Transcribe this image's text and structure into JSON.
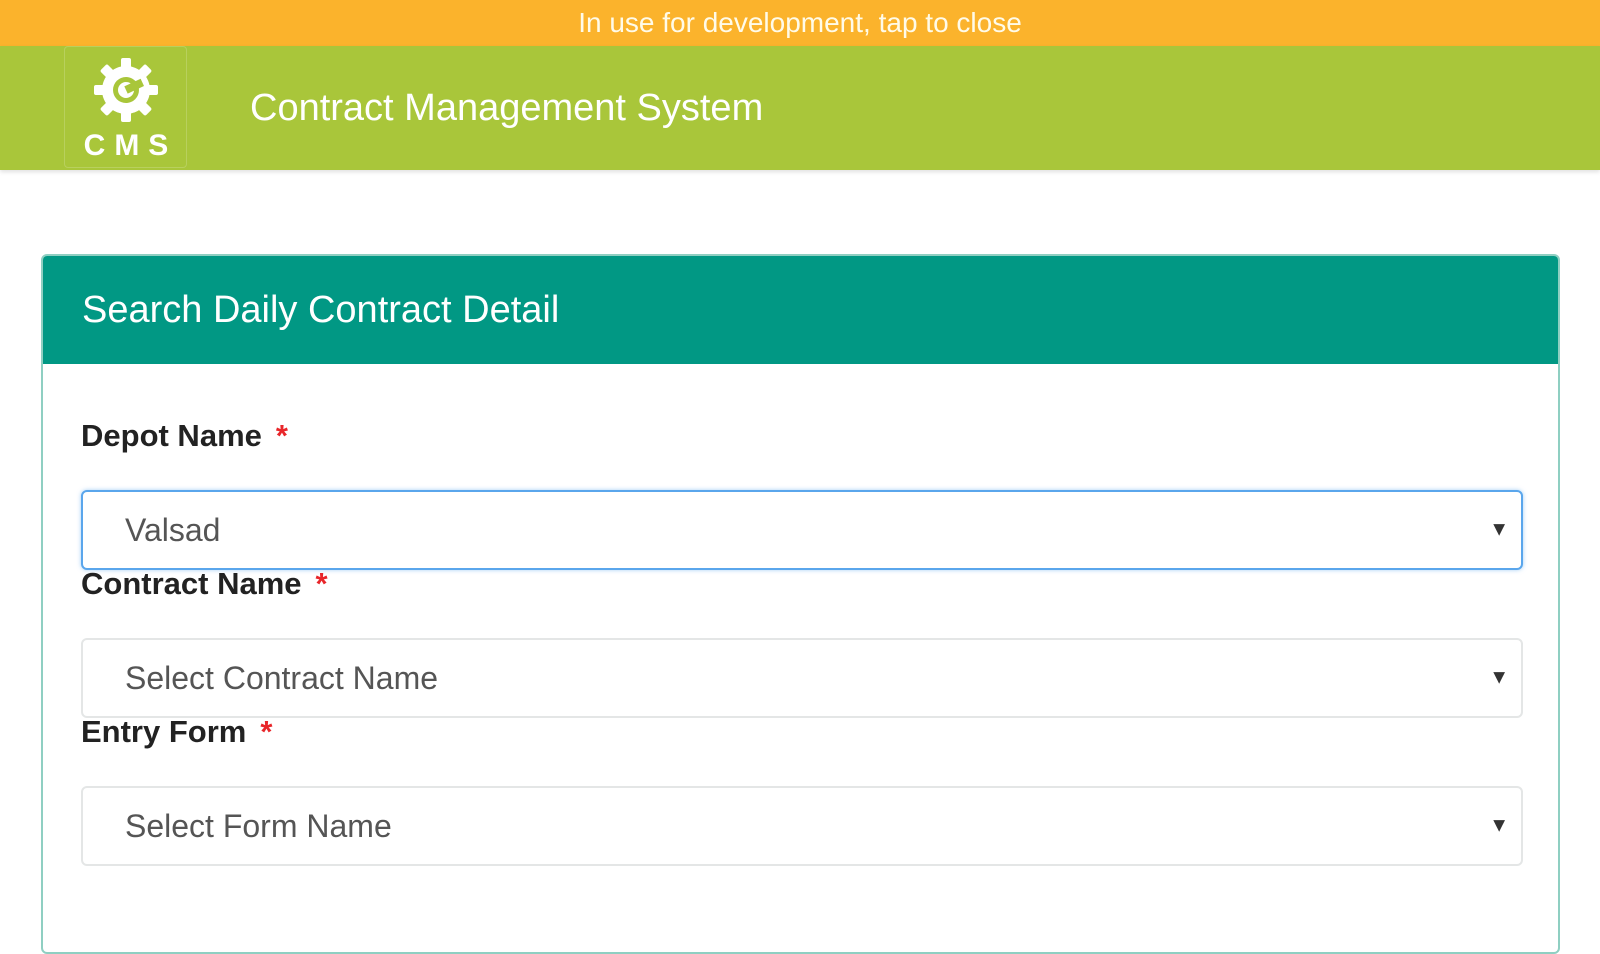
{
  "dev_banner": {
    "text": "In use for development, tap to close",
    "color": "#fbb32c"
  },
  "header": {
    "logo_text": "CMS",
    "logo_icon": "gear-wrench-icon",
    "title": "Contract Management System",
    "color": "#a9c63a"
  },
  "card": {
    "title": "Search Daily Contract Detail",
    "header_color": "#019884",
    "fields": [
      {
        "label": "Depot Name",
        "required_mark": "*",
        "value": "Valsad"
      },
      {
        "label": "Contract Name",
        "required_mark": "*",
        "value": "Select Contract Name"
      },
      {
        "label": "Entry Form",
        "required_mark": "*",
        "value": "Select Form Name"
      }
    ],
    "dropdown_icon": "caret-down-icon",
    "dropdown_glyph": "▼"
  }
}
